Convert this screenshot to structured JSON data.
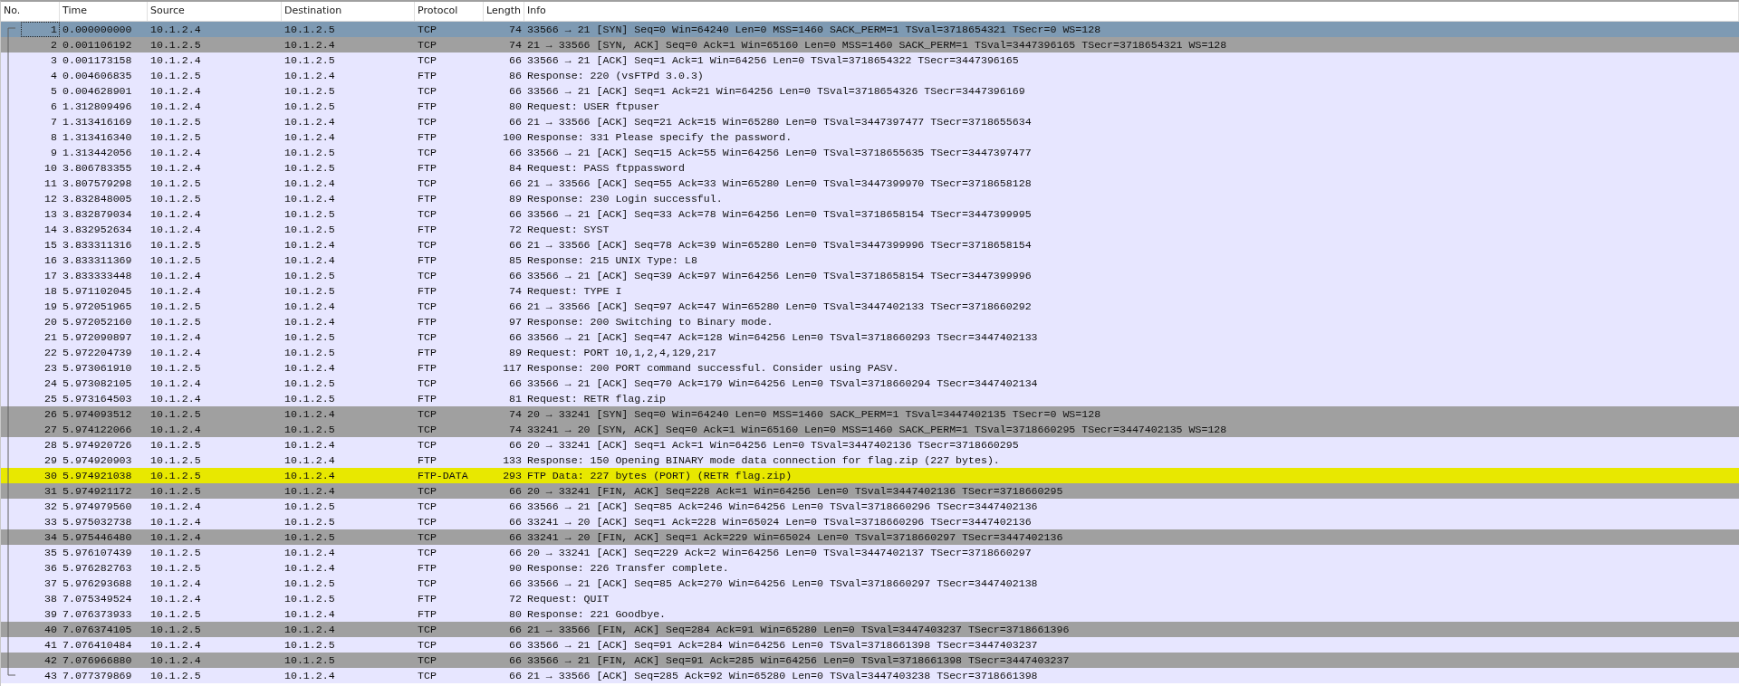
{
  "table": {
    "columns": [
      "No.",
      "Time",
      "Source",
      "Destination",
      "Protocol",
      "Length",
      "Info"
    ],
    "rows": [
      {
        "no": "1",
        "time": "0.000000000",
        "source": "10.1.2.4",
        "destination": "10.1.2.5",
        "protocol": "TCP",
        "length": "74",
        "info": "33566 → 21 [SYN] Seq=0 Win=64240 Len=0 MSS=1460 SACK_PERM=1 TSval=3718654321 TSecr=0 WS=128",
        "kind": "gray",
        "selected": true
      },
      {
        "no": "2",
        "time": "0.001106192",
        "source": "10.1.2.5",
        "destination": "10.1.2.4",
        "protocol": "TCP",
        "length": "74",
        "info": "21 → 33566 [SYN, ACK] Seq=0 Ack=1 Win=65160 Len=0 MSS=1460 SACK_PERM=1 TSval=3447396165 TSecr=3718654321 WS=128",
        "kind": "gray",
        "selected": false
      },
      {
        "no": "3",
        "time": "0.001173158",
        "source": "10.1.2.4",
        "destination": "10.1.2.5",
        "protocol": "TCP",
        "length": "66",
        "info": "33566 → 21 [ACK] Seq=1 Ack=1 Win=64256 Len=0 TSval=3718654322 TSecr=3447396165",
        "kind": "normal",
        "selected": false
      },
      {
        "no": "4",
        "time": "0.004606835",
        "source": "10.1.2.5",
        "destination": "10.1.2.4",
        "protocol": "FTP",
        "length": "86",
        "info": "Response: 220 (vsFTPd 3.0.3)",
        "kind": "normal",
        "selected": false
      },
      {
        "no": "5",
        "time": "0.004628901",
        "source": "10.1.2.4",
        "destination": "10.1.2.5",
        "protocol": "TCP",
        "length": "66",
        "info": "33566 → 21 [ACK] Seq=1 Ack=21 Win=64256 Len=0 TSval=3718654326 TSecr=3447396169",
        "kind": "normal",
        "selected": false
      },
      {
        "no": "6",
        "time": "1.312809496",
        "source": "10.1.2.4",
        "destination": "10.1.2.5",
        "protocol": "FTP",
        "length": "80",
        "info": "Request: USER ftpuser",
        "kind": "normal",
        "selected": false
      },
      {
        "no": "7",
        "time": "1.313416169",
        "source": "10.1.2.5",
        "destination": "10.1.2.4",
        "protocol": "TCP",
        "length": "66",
        "info": "21 → 33566 [ACK] Seq=21 Ack=15 Win=65280 Len=0 TSval=3447397477 TSecr=3718655634",
        "kind": "normal",
        "selected": false
      },
      {
        "no": "8",
        "time": "1.313416340",
        "source": "10.1.2.5",
        "destination": "10.1.2.4",
        "protocol": "FTP",
        "length": "100",
        "info": "Response: 331 Please specify the password.",
        "kind": "normal",
        "selected": false
      },
      {
        "no": "9",
        "time": "1.313442056",
        "source": "10.1.2.4",
        "destination": "10.1.2.5",
        "protocol": "TCP",
        "length": "66",
        "info": "33566 → 21 [ACK] Seq=15 Ack=55 Win=64256 Len=0 TSval=3718655635 TSecr=3447397477",
        "kind": "normal",
        "selected": false
      },
      {
        "no": "10",
        "time": "3.806783355",
        "source": "10.1.2.4",
        "destination": "10.1.2.5",
        "protocol": "FTP",
        "length": "84",
        "info": "Request: PASS ftppassword",
        "kind": "normal",
        "selected": false
      },
      {
        "no": "11",
        "time": "3.807579298",
        "source": "10.1.2.5",
        "destination": "10.1.2.4",
        "protocol": "TCP",
        "length": "66",
        "info": "21 → 33566 [ACK] Seq=55 Ack=33 Win=65280 Len=0 TSval=3447399970 TSecr=3718658128",
        "kind": "normal",
        "selected": false
      },
      {
        "no": "12",
        "time": "3.832848005",
        "source": "10.1.2.5",
        "destination": "10.1.2.4",
        "protocol": "FTP",
        "length": "89",
        "info": "Response: 230 Login successful.",
        "kind": "normal",
        "selected": false
      },
      {
        "no": "13",
        "time": "3.832879034",
        "source": "10.1.2.4",
        "destination": "10.1.2.5",
        "protocol": "TCP",
        "length": "66",
        "info": "33566 → 21 [ACK] Seq=33 Ack=78 Win=64256 Len=0 TSval=3718658154 TSecr=3447399995",
        "kind": "normal",
        "selected": false
      },
      {
        "no": "14",
        "time": "3.832952634",
        "source": "10.1.2.4",
        "destination": "10.1.2.5",
        "protocol": "FTP",
        "length": "72",
        "info": "Request: SYST",
        "kind": "normal",
        "selected": false
      },
      {
        "no": "15",
        "time": "3.833311316",
        "source": "10.1.2.5",
        "destination": "10.1.2.4",
        "protocol": "TCP",
        "length": "66",
        "info": "21 → 33566 [ACK] Seq=78 Ack=39 Win=65280 Len=0 TSval=3447399996 TSecr=3718658154",
        "kind": "normal",
        "selected": false
      },
      {
        "no": "16",
        "time": "3.833311369",
        "source": "10.1.2.5",
        "destination": "10.1.2.4",
        "protocol": "FTP",
        "length": "85",
        "info": "Response: 215 UNIX Type: L8",
        "kind": "normal",
        "selected": false
      },
      {
        "no": "17",
        "time": "3.833333448",
        "source": "10.1.2.4",
        "destination": "10.1.2.5",
        "protocol": "TCP",
        "length": "66",
        "info": "33566 → 21 [ACK] Seq=39 Ack=97 Win=64256 Len=0 TSval=3718658154 TSecr=3447399996",
        "kind": "normal",
        "selected": false
      },
      {
        "no": "18",
        "time": "5.971102045",
        "source": "10.1.2.4",
        "destination": "10.1.2.5",
        "protocol": "FTP",
        "length": "74",
        "info": "Request: TYPE I",
        "kind": "normal",
        "selected": false
      },
      {
        "no": "19",
        "time": "5.972051965",
        "source": "10.1.2.5",
        "destination": "10.1.2.4",
        "protocol": "TCP",
        "length": "66",
        "info": "21 → 33566 [ACK] Seq=97 Ack=47 Win=65280 Len=0 TSval=3447402133 TSecr=3718660292",
        "kind": "normal",
        "selected": false
      },
      {
        "no": "20",
        "time": "5.972052160",
        "source": "10.1.2.5",
        "destination": "10.1.2.4",
        "protocol": "FTP",
        "length": "97",
        "info": "Response: 200 Switching to Binary mode.",
        "kind": "normal",
        "selected": false
      },
      {
        "no": "21",
        "time": "5.972090897",
        "source": "10.1.2.4",
        "destination": "10.1.2.5",
        "protocol": "TCP",
        "length": "66",
        "info": "33566 → 21 [ACK] Seq=47 Ack=128 Win=64256 Len=0 TSval=3718660293 TSecr=3447402133",
        "kind": "normal",
        "selected": false
      },
      {
        "no": "22",
        "time": "5.972204739",
        "source": "10.1.2.4",
        "destination": "10.1.2.5",
        "protocol": "FTP",
        "length": "89",
        "info": "Request: PORT 10,1,2,4,129,217",
        "kind": "normal",
        "selected": false
      },
      {
        "no": "23",
        "time": "5.973061910",
        "source": "10.1.2.5",
        "destination": "10.1.2.4",
        "protocol": "FTP",
        "length": "117",
        "info": "Response: 200 PORT command successful. Consider using PASV.",
        "kind": "normal",
        "selected": false
      },
      {
        "no": "24",
        "time": "5.973082105",
        "source": "10.1.2.4",
        "destination": "10.1.2.5",
        "protocol": "TCP",
        "length": "66",
        "info": "33566 → 21 [ACK] Seq=70 Ack=179 Win=64256 Len=0 TSval=3718660294 TSecr=3447402134",
        "kind": "normal",
        "selected": false
      },
      {
        "no": "25",
        "time": "5.973164503",
        "source": "10.1.2.4",
        "destination": "10.1.2.5",
        "protocol": "FTP",
        "length": "81",
        "info": "Request: RETR flag.zip",
        "kind": "normal",
        "selected": false
      },
      {
        "no": "26",
        "time": "5.974093512",
        "source": "10.1.2.5",
        "destination": "10.1.2.4",
        "protocol": "TCP",
        "length": "74",
        "info": "20 → 33241 [SYN] Seq=0 Win=64240 Len=0 MSS=1460 SACK_PERM=1 TSval=3447402135 TSecr=0 WS=128",
        "kind": "gray",
        "selected": false
      },
      {
        "no": "27",
        "time": "5.974122066",
        "source": "10.1.2.4",
        "destination": "10.1.2.5",
        "protocol": "TCP",
        "length": "74",
        "info": "33241 → 20 [SYN, ACK] Seq=0 Ack=1 Win=65160 Len=0 MSS=1460 SACK_PERM=1 TSval=3718660295 TSecr=3447402135 WS=128",
        "kind": "gray",
        "selected": false
      },
      {
        "no": "28",
        "time": "5.974920726",
        "source": "10.1.2.5",
        "destination": "10.1.2.4",
        "protocol": "TCP",
        "length": "66",
        "info": "20 → 33241 [ACK] Seq=1 Ack=1 Win=64256 Len=0 TSval=3447402136 TSecr=3718660295",
        "kind": "normal",
        "selected": false
      },
      {
        "no": "29",
        "time": "5.974920903",
        "source": "10.1.2.5",
        "destination": "10.1.2.4",
        "protocol": "FTP",
        "length": "133",
        "info": "Response: 150 Opening BINARY mode data connection for flag.zip (227 bytes).",
        "kind": "normal",
        "selected": false
      },
      {
        "no": "30",
        "time": "5.974921038",
        "source": "10.1.2.5",
        "destination": "10.1.2.4",
        "protocol": "FTP-DATA",
        "length": "293",
        "info": "FTP Data: 227 bytes (PORT) (RETR flag.zip)",
        "kind": "highlighted",
        "selected": false
      },
      {
        "no": "31",
        "time": "5.974921172",
        "source": "10.1.2.5",
        "destination": "10.1.2.4",
        "protocol": "TCP",
        "length": "66",
        "info": "20 → 33241 [FIN, ACK] Seq=228 Ack=1 Win=64256 Len=0 TSval=3447402136 TSecr=3718660295",
        "kind": "gray",
        "selected": false
      },
      {
        "no": "32",
        "time": "5.974979560",
        "source": "10.1.2.4",
        "destination": "10.1.2.5",
        "protocol": "TCP",
        "length": "66",
        "info": "33566 → 21 [ACK] Seq=85 Ack=246 Win=64256 Len=0 TSval=3718660296 TSecr=3447402136",
        "kind": "normal",
        "selected": false
      },
      {
        "no": "33",
        "time": "5.975032738",
        "source": "10.1.2.4",
        "destination": "10.1.2.5",
        "protocol": "TCP",
        "length": "66",
        "info": "33241 → 20 [ACK] Seq=1 Ack=228 Win=65024 Len=0 TSval=3718660296 TSecr=3447402136",
        "kind": "normal",
        "selected": false
      },
      {
        "no": "34",
        "time": "5.975446480",
        "source": "10.1.2.4",
        "destination": "10.1.2.5",
        "protocol": "TCP",
        "length": "66",
        "info": "33241 → 20 [FIN, ACK] Seq=1 Ack=229 Win=65024 Len=0 TSval=3718660297 TSecr=3447402136",
        "kind": "gray",
        "selected": false
      },
      {
        "no": "35",
        "time": "5.976107439",
        "source": "10.1.2.5",
        "destination": "10.1.2.4",
        "protocol": "TCP",
        "length": "66",
        "info": "20 → 33241 [ACK] Seq=229 Ack=2 Win=64256 Len=0 TSval=3447402137 TSecr=3718660297",
        "kind": "normal",
        "selected": false
      },
      {
        "no": "36",
        "time": "5.976282763",
        "source": "10.1.2.5",
        "destination": "10.1.2.4",
        "protocol": "FTP",
        "length": "90",
        "info": "Response: 226 Transfer complete.",
        "kind": "normal",
        "selected": false
      },
      {
        "no": "37",
        "time": "5.976293688",
        "source": "10.1.2.4",
        "destination": "10.1.2.5",
        "protocol": "TCP",
        "length": "66",
        "info": "33566 → 21 [ACK] Seq=85 Ack=270 Win=64256 Len=0 TSval=3718660297 TSecr=3447402138",
        "kind": "normal",
        "selected": false
      },
      {
        "no": "38",
        "time": "7.075349524",
        "source": "10.1.2.4",
        "destination": "10.1.2.5",
        "protocol": "FTP",
        "length": "72",
        "info": "Request: QUIT",
        "kind": "normal",
        "selected": false
      },
      {
        "no": "39",
        "time": "7.076373933",
        "source": "10.1.2.5",
        "destination": "10.1.2.4",
        "protocol": "FTP",
        "length": "80",
        "info": "Response: 221 Goodbye.",
        "kind": "normal",
        "selected": false
      },
      {
        "no": "40",
        "time": "7.076374105",
        "source": "10.1.2.5",
        "destination": "10.1.2.4",
        "protocol": "TCP",
        "length": "66",
        "info": "21 → 33566 [FIN, ACK] Seq=284 Ack=91 Win=65280 Len=0 TSval=3447403237 TSecr=3718661396",
        "kind": "gray",
        "selected": false
      },
      {
        "no": "41",
        "time": "7.076410484",
        "source": "10.1.2.4",
        "destination": "10.1.2.5",
        "protocol": "TCP",
        "length": "66",
        "info": "33566 → 21 [ACK] Seq=91 Ack=284 Win=64256 Len=0 TSval=3718661398 TSecr=3447403237",
        "kind": "normal",
        "selected": false
      },
      {
        "no": "42",
        "time": "7.076966880",
        "source": "10.1.2.4",
        "destination": "10.1.2.5",
        "protocol": "TCP",
        "length": "66",
        "info": "33566 → 21 [FIN, ACK] Seq=91 Ack=285 Win=64256 Len=0 TSval=3718661398 TSecr=3447403237",
        "kind": "gray",
        "selected": false
      },
      {
        "no": "43",
        "time": "7.077379869",
        "source": "10.1.2.5",
        "destination": "10.1.2.4",
        "protocol": "TCP",
        "length": "66",
        "info": "21 → 33566 [ACK] Seq=285 Ack=92 Win=65280 Len=0 TSval=3447403238 TSecr=3718661398",
        "kind": "normal",
        "selected": false
      }
    ]
  }
}
